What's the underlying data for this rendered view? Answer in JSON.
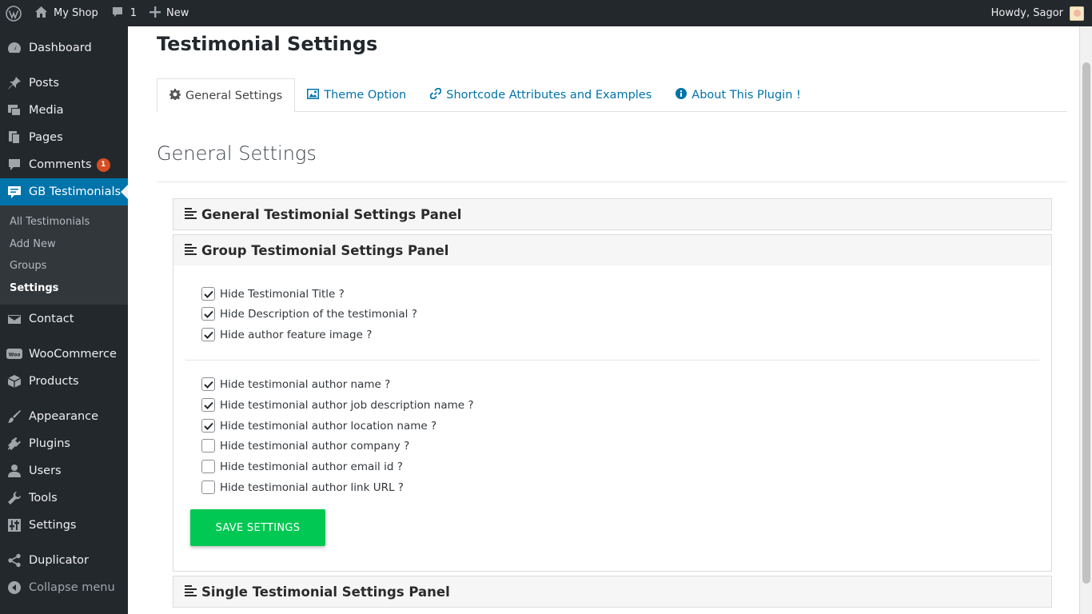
{
  "adminbar": {
    "site_name": "My Shop",
    "comments_count": "1",
    "new_label": "New",
    "howdy": "Howdy, Sagor"
  },
  "sidebar": {
    "dashboard": "Dashboard",
    "posts": "Posts",
    "media": "Media",
    "pages": "Pages",
    "comments": "Comments",
    "comments_badge": "1",
    "gb_testimonials": "GB Testimonials",
    "submenu": [
      "All Testimonials",
      "Add New",
      "Groups",
      "Settings"
    ],
    "contact": "Contact",
    "woocommerce": "WooCommerce",
    "products": "Products",
    "appearance": "Appearance",
    "plugins": "Plugins",
    "users": "Users",
    "tools": "Tools",
    "settings": "Settings",
    "duplicator": "Duplicator",
    "collapse": "Collapse menu"
  },
  "page": {
    "title": "Testimonial Settings",
    "tabs": [
      "General Settings",
      "Theme Option",
      "Shortcode Attributes and Examples",
      "About This Plugin !"
    ],
    "section_title": "General Settings"
  },
  "panels": {
    "general": "General Testimonial Settings Panel",
    "group": "Group Testimonial Settings Panel",
    "single": "Single Testimonial Settings Panel"
  },
  "options": [
    {
      "label": "Hide Testimonial Title ?",
      "checked": true
    },
    {
      "label": "Hide Description of the testimonial ?",
      "checked": true
    },
    {
      "label": "Hide author feature image ?",
      "checked": true
    },
    {
      "label": "Hide testimonial author name ?",
      "checked": true
    },
    {
      "label": "Hide testimonial author job description name ?",
      "checked": true
    },
    {
      "label": "Hide testimonial author location name ?",
      "checked": true
    },
    {
      "label": "Hide testimonial author company ?",
      "checked": false
    },
    {
      "label": "Hide testimonial author email id ?",
      "checked": false
    },
    {
      "label": "Hide testimonial author link URL ?",
      "checked": false
    }
  ],
  "save_label": "SAVE SETTINGS",
  "colors": {
    "admin_dark": "#23282d",
    "accent": "#0073aa",
    "save_button": "#00c853",
    "badge": "#d54e21"
  }
}
